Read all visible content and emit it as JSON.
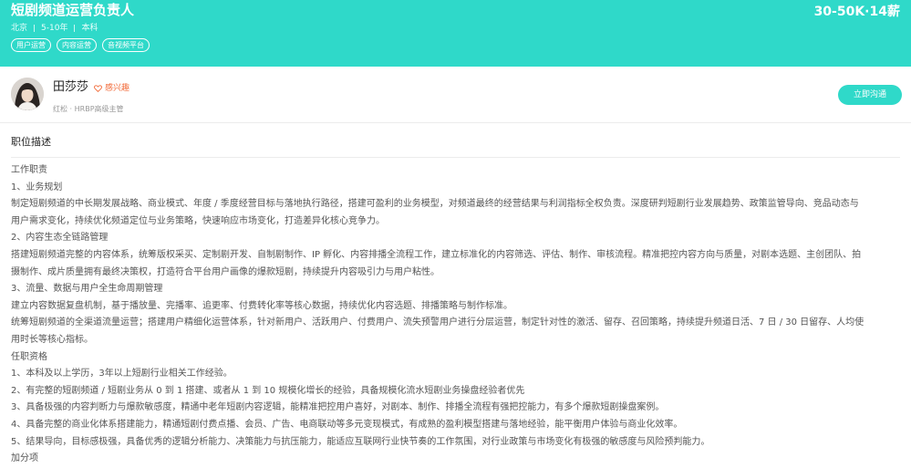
{
  "header": {
    "title": "短剧频道运营负责人",
    "salary": "30-50K·14薪",
    "meta": [
      "北京",
      "5-10年",
      "本科"
    ],
    "tags": [
      "用户运营",
      "内容运营",
      "音视频平台"
    ],
    "background_color": "#2fd9c9"
  },
  "recruiter": {
    "name": "田莎莎",
    "interest_label": "感兴趣",
    "info": "红松 · HRBP高级主管",
    "chat_button": "立即沟通"
  },
  "description": {
    "title": "职位描述",
    "lines": [
      "工作职责",
      "1、业务规划",
      "制定短剧频道的中长期发展战略、商业模式、年度 / 季度经营目标与落地执行路径，搭建可盈利的业务模型，对频道最终的经营结果与利润指标全权负责。深度研判短剧行业发展趋势、政策监管导向、竞品动态与",
      "用户需求变化，持续优化频道定位与业务策略，快速响应市场变化，打造差异化核心竞争力。",
      "2、内容生态全链路管理",
      "搭建短剧频道完整的内容体系，统筹版权采买、定制剧开发、自制剧制作、IP 孵化、内容排播全流程工作，建立标准化的内容筛选、评估、制作、审核流程。精准把控内容方向与质量，对剧本选题、主创团队、拍",
      "摄制作、成片质量拥有最终决策权，打造符合平台用户画像的爆款短剧，持续提升内容吸引力与用户粘性。",
      "3、流量、数据与用户全生命周期管理",
      "建立内容数据复盘机制，基于播放量、完播率、追更率、付费转化率等核心数据，持续优化内容选题、排播策略与制作标准。",
      "统筹短剧频道的全渠道流量运营；搭建用户精细化运营体系，针对新用户、活跃用户、付费用户、流失预警用户进行分层运营，制定针对性的激活、留存、召回策略，持续提升频道日活、7 日 / 30 日留存、人均使",
      "用时长等核心指标。",
      "任职资格",
      "1、本科及以上学历，3年以上短剧行业相关工作经验。",
      "2、有完整的短剧频道 / 短剧业务从 0 到 1 搭建、或者从 1 到 10 规模化增长的经验，具备规模化流水短剧业务操盘经验者优先",
      "3、具备极强的内容判断力与爆款敏感度，精通中老年短剧内容逻辑，能精准把控用户喜好，对剧本、制作、排播全流程有强把控能力，有多个爆款短剧操盘案例。",
      "4、具备完整的商业化体系搭建能力，精通短剧付费点播、会员、广告、电商联动等多元变现模式，有成熟的盈利模型搭建与落地经验，能平衡用户体验与商业化效率。",
      "5、结果导向，目标感极强，具备优秀的逻辑分析能力、决策能力与抗压能力，能适应互联网行业快节奏的工作氛围，对行业政策与市场变化有极强的敏感度与风险预判能力。",
      "加分项"
    ]
  }
}
